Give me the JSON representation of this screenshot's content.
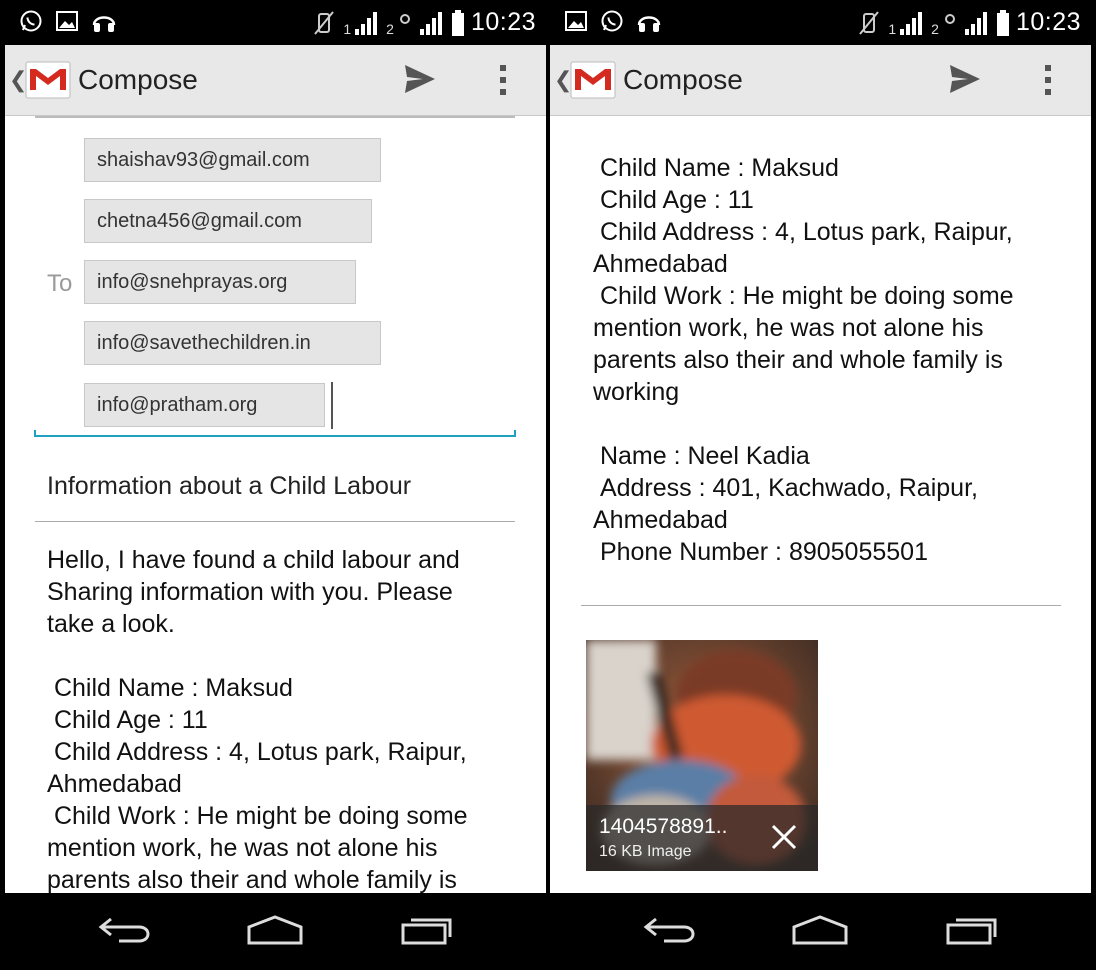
{
  "status_bar": {
    "time": "10:23",
    "sim1": "1",
    "sim2": "2"
  },
  "action_bar": {
    "title": "Compose"
  },
  "compose": {
    "to_label": "To",
    "recipients": [
      "shaishav93@gmail.com",
      "chetna456@gmail.com",
      "info@snehprayas.org",
      "info@savethechildren.in",
      "info@pratham.org"
    ],
    "subject": "Information about a Child Labour",
    "body_left": "Hello, I have found a child labour and\nSharing information with you. Please\ntake a look.\n\n Child Name : Maksud\n Child Age : 11\n Child Address : 4, Lotus park, Raipur,\nAhmedabad\n Child Work : He might be doing some\nmention work, he was not alone his\nparents also their and whole family is",
    "body_right": " Child Name : Maksud\n Child Age : 11\n Child Address : 4, Lotus park, Raipur,\nAhmedabad\n Child Work : He might be doing some\nmention work, he was not alone his\nparents also their and whole family is\nworking\n\n Name : Neel Kadia\n Address : 401, Kachwado, Raipur,\nAhmedabad\n Phone Number : 8905055501",
    "attachment": {
      "name": "1404578891..",
      "size": "16 KB Image"
    }
  }
}
